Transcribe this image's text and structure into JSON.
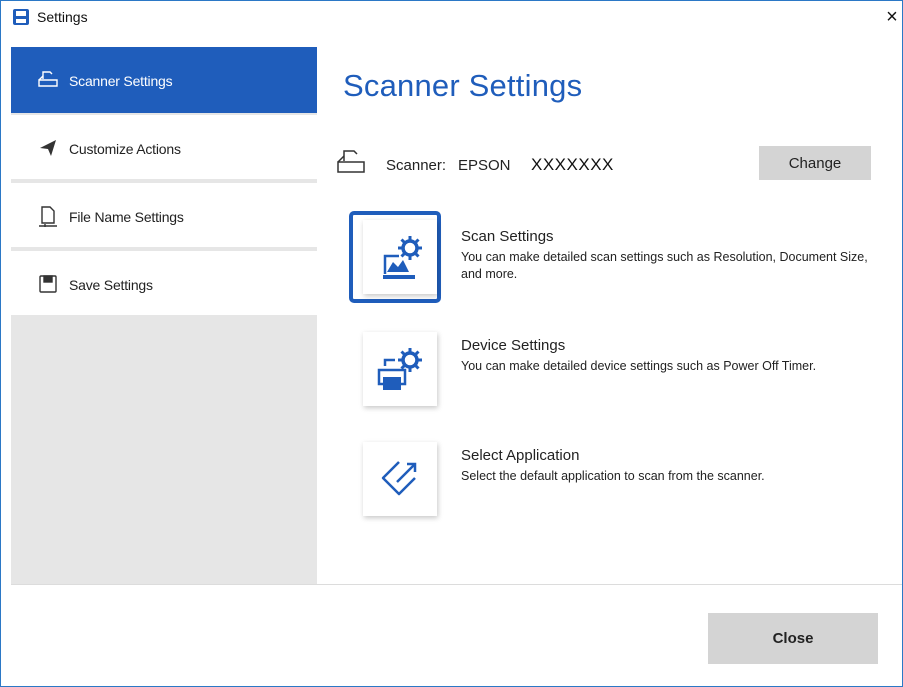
{
  "window": {
    "title": "Settings",
    "close_glyph": "×"
  },
  "sidebar": {
    "items": [
      {
        "label": "Scanner Settings",
        "icon": "scanner-icon",
        "active": true
      },
      {
        "label": "Customize Actions",
        "icon": "paper-plane-icon",
        "active": false
      },
      {
        "label": "File Name Settings",
        "icon": "document-icon",
        "active": false
      },
      {
        "label": "Save Settings",
        "icon": "save-icon",
        "active": false
      }
    ]
  },
  "main": {
    "title": "Scanner Settings",
    "scanner": {
      "label": "Scanner:",
      "value": "EPSON",
      "model": "XXXXXXX",
      "change_label": "Change"
    },
    "options": [
      {
        "title": "Scan Settings",
        "description": "You can make detailed scan settings such as Resolution, Document Size, and more.",
        "icon": "scan-settings-gear-icon",
        "selected": true
      },
      {
        "title": "Device Settings",
        "description": "You can make detailed device settings such as Power Off Timer.",
        "icon": "device-settings-gear-icon",
        "selected": false
      },
      {
        "title": "Select Application",
        "description": "Select the default application to scan from the scanner.",
        "icon": "select-application-icon",
        "selected": false
      }
    ]
  },
  "footer": {
    "close_label": "Close"
  },
  "colors": {
    "accent": "#1f5dbb",
    "sidebar_bg": "#e6e6e6",
    "button_bg": "#d4d4d4"
  }
}
